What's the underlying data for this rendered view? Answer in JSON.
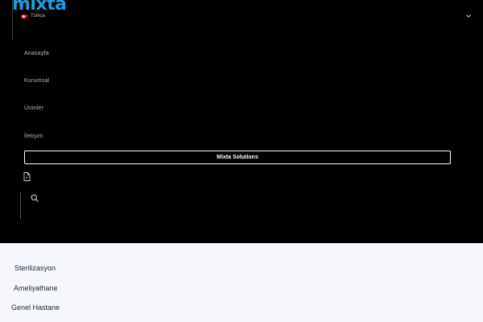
{
  "header": {
    "logo_text": "mixta",
    "language": {
      "label": "Türkçe",
      "flag": "tr-flag"
    },
    "expand_icon": "chevron-down-icon"
  },
  "menu": {
    "items": [
      {
        "label": "Anasayfa"
      },
      {
        "label": "Kurumsal"
      },
      {
        "label": "Ürünler"
      },
      {
        "label": "İletişim"
      }
    ],
    "cta_label": "Mixta Solutions",
    "icons": [
      "document-icon",
      "search-icon"
    ]
  },
  "categories": [
    {
      "label": "Sterilizasyon"
    },
    {
      "label": "Ameliyathane"
    },
    {
      "label": "Genel Hastane"
    }
  ],
  "colors": {
    "brand": "#1f9bde",
    "panel": "#000000",
    "page_background": "#f5f7fc",
    "flag_red": "#e30a17"
  }
}
